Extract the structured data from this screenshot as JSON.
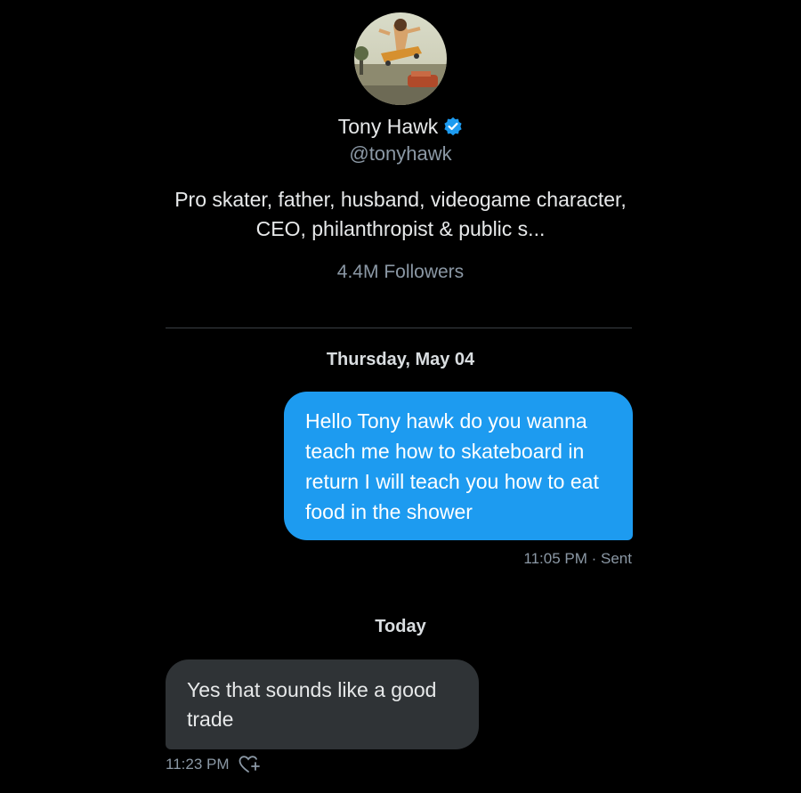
{
  "profile": {
    "name": "Tony Hawk",
    "handle": "@tonyhawk",
    "bio": "Pro skater, father, husband, videogame character, CEO, philanthropist & public s...",
    "followers": "4.4M Followers",
    "verified_color": "#1d9bf0"
  },
  "conversation": {
    "date_1": "Thursday, May 04",
    "sent_message": "Hello Tony hawk do you wanna teach me how to skateboard in return I will teach you how to eat food in the shower",
    "sent_meta": "11:05 PM · Sent",
    "date_2": "Today",
    "received_message": "Yes that sounds like a good trade",
    "received_meta": "11:23 PM"
  },
  "colors": {
    "background": "#000000",
    "sent_bubble": "#1d9bf0",
    "received_bubble": "#2f3336",
    "secondary_text": "#8b98a5"
  },
  "icons": {
    "verified": "verified-badge-icon",
    "reaction": "add-reaction-heart-icon"
  }
}
